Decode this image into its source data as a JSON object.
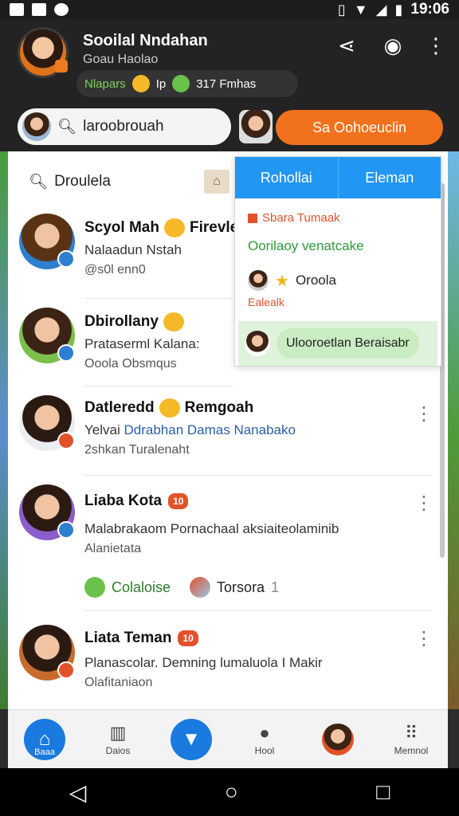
{
  "status_bar": {
    "time": "19:06"
  },
  "header": {
    "title": "Sooilal Nndahan",
    "subtitle": "Goau Haolao",
    "stats": {
      "a": "Nlapars",
      "b": "Ip",
      "c": "317 Fmhas"
    },
    "colors": {
      "accent": "#f2711c",
      "primary": "#1a7ae0"
    }
  },
  "search": {
    "value": "laroobrouah",
    "cta_label": "Sa Oohoeuclin"
  },
  "list_search": {
    "value": "Droulela"
  },
  "contacts": [
    {
      "name": "Scyol Mah",
      "name_suffix": "Firevle",
      "line2": "Nalaadun Nstah",
      "line3": "@s0l enn0"
    },
    {
      "name": "Dbirollany",
      "line2": "Prataserml Kalana:",
      "line3": "Ooola Obsmqus"
    },
    {
      "name": "Datleredd",
      "name_suffix": "Remgoah",
      "line2_prefix": "Yelvai",
      "line2_link": "Ddrabhan Damas Nanabako",
      "line3": "2shkan Turalenaht"
    },
    {
      "name": "Liaba Kota",
      "tag": "10",
      "line2": "Malabrakaom Pornachaal aksiaiteolaminib",
      "line3": "Alanietata",
      "chips": [
        {
          "label": "Colaloise"
        },
        {
          "label": "Torsora",
          "count": "1"
        }
      ]
    },
    {
      "name": "Liata Teman",
      "tag": "10",
      "line2": "Planascolar. Demning lumaluola I Makir",
      "line3": "Olafitaniaon"
    }
  ],
  "popover": {
    "tabs": [
      "Rohollai",
      "Eleman"
    ],
    "title": "Sbara Tumaak",
    "green_text": "Oorilaoy venatcake",
    "user_name": "Oroola",
    "small_text": "Ealealk",
    "button_label": "Ulooroetlan Beraisabr"
  },
  "bottom_nav": [
    {
      "label": "Baaa"
    },
    {
      "label": "Daios"
    },
    {
      "label": ""
    },
    {
      "label": "Hool"
    },
    {
      "label": ""
    },
    {
      "label": "Memnol"
    }
  ]
}
